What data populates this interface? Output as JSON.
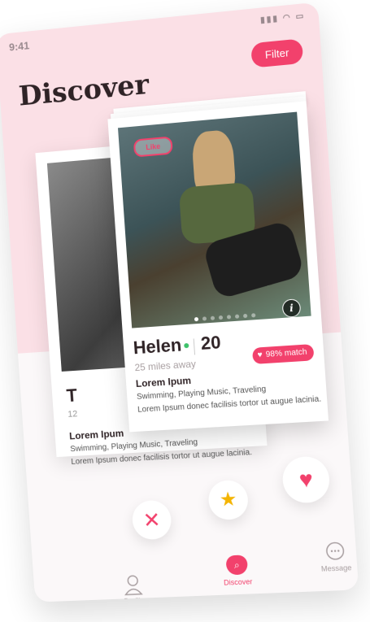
{
  "status": {
    "time": "9:41",
    "icons": "▮▮▮ ◠ ▭"
  },
  "header": {
    "title": "Discover",
    "filter_label": "Filter"
  },
  "back_card": {
    "name_initial": "T",
    "distance": "12",
    "subtitle": "Lorem Ipum",
    "hobbies": "Swimming, Playing Music, Traveling",
    "description": "Lorem Ipsum donec facilisis tortor ut augue lacinia."
  },
  "profile_card": {
    "like_tag": "Like",
    "name": "Helen",
    "age": "20",
    "distance": "25 miles away",
    "match_label": "98% match",
    "match_value": 98,
    "subtitle": "Lorem Ipum",
    "hobbies": "Swimming, Playing Music, Traveling",
    "description": "Lorem Ipsum donec facilisis tortor ut augue lacinia.",
    "photo_count": 8,
    "active_photo": 1,
    "online": true
  },
  "actions": [
    {
      "icon": "close-icon",
      "glyph": "✕"
    },
    {
      "icon": "star-icon",
      "glyph": "★"
    },
    {
      "icon": "heart-icon",
      "glyph": "♥"
    }
  ],
  "nav": {
    "profile_label": "Profile",
    "discover_label": "Discover",
    "message_label": "Message"
  },
  "colors": {
    "accent": "#f2416c",
    "header_bg": "#fbe0e6",
    "online": "#3ec26b",
    "star": "#f4b400"
  }
}
